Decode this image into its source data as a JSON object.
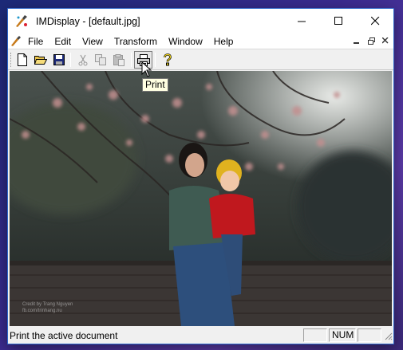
{
  "window": {
    "title": "IMDisplay - [default.jpg]",
    "controls": {
      "minimize_icon": "minimize-icon",
      "maximize_icon": "maximize-icon",
      "close_icon": "close-icon"
    }
  },
  "menu": {
    "items": [
      "File",
      "Edit",
      "View",
      "Transform",
      "Window",
      "Help"
    ]
  },
  "toolbar": {
    "buttons": [
      "new-icon",
      "open-icon",
      "save-icon",
      "cut-icon",
      "copy-icon",
      "paste-icon",
      "print-icon",
      "help-icon"
    ]
  },
  "tooltip": {
    "text": "Print"
  },
  "image": {
    "watermark_line1": "Credit by Trang Nguyen",
    "watermark_line2": "fb.com/trinhang.nu"
  },
  "status": {
    "message": "Print the active document",
    "pane_caps": "",
    "pane_num": "NUM",
    "pane_scrl": ""
  },
  "colors": {
    "accent_border": "#2a64c8",
    "tooltip_bg": "#ffffe1"
  }
}
